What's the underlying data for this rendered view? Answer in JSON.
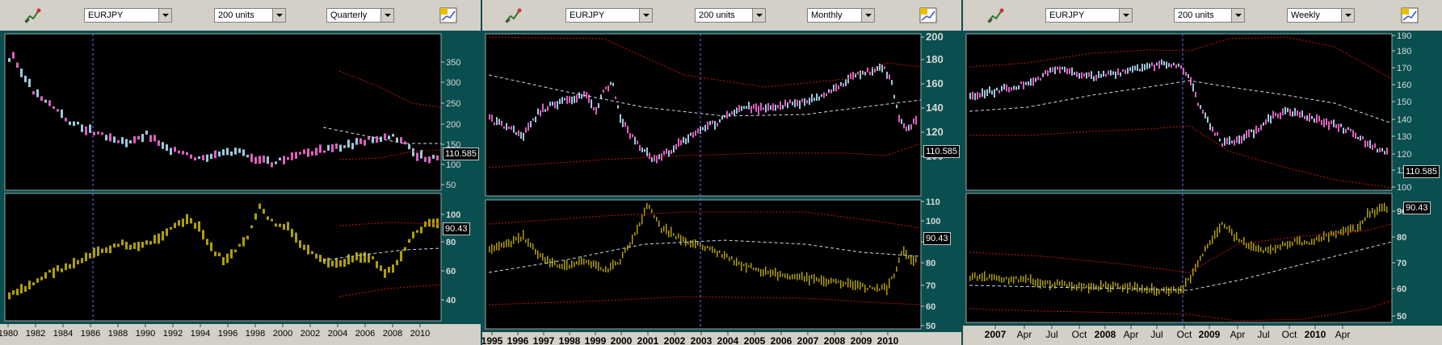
{
  "panels": [
    {
      "id": "quarterly",
      "symbol": "EURJPY",
      "units": "200 units",
      "period": "Quarterly",
      "price_badge": "110.585",
      "indicator_badge": "90.43",
      "price_ticks": [
        "350",
        "300",
        "250",
        "200",
        "150",
        "100",
        "50"
      ],
      "indicator_ticks": [
        "100",
        "80",
        "60",
        "40"
      ],
      "time_ticks": [
        "1980",
        "1982",
        "1984",
        "1986",
        "1988",
        "1990",
        "1992",
        "1994",
        "1996",
        "1998",
        "2000",
        "2002",
        "2004",
        "2006",
        "2008",
        "2010"
      ]
    },
    {
      "id": "monthly",
      "symbol": "EURJPY",
      "units": "200 units",
      "period": "Monthly",
      "price_badge": "110.585",
      "indicator_badge": "90.43",
      "price_ticks": [
        "200",
        "180",
        "160",
        "140",
        "120",
        "100"
      ],
      "indicator_ticks": [
        "110",
        "100",
        "90",
        "80",
        "70",
        "60",
        "50"
      ],
      "time_ticks": [
        "1995",
        "1996",
        "1997",
        "1998",
        "1999",
        "2000",
        "2001",
        "2002",
        "2003",
        "2004",
        "2005",
        "2006",
        "2007",
        "2008",
        "2009",
        "2010"
      ]
    },
    {
      "id": "weekly",
      "symbol": "EURJPY",
      "units": "200 units",
      "period": "Weekly",
      "price_badge": "110.585",
      "indicator_badge": "90.43",
      "price_ticks": [
        "190",
        "180",
        "170",
        "160",
        "150",
        "140",
        "130",
        "120",
        "110",
        "100"
      ],
      "indicator_ticks": [
        "90",
        "80",
        "70",
        "60",
        "50"
      ],
      "time_ticks": [
        "2007",
        "Apr",
        "Jul",
        "Oct",
        "2008",
        "Apr",
        "Jul",
        "Oct",
        "2009",
        "Apr",
        "Jul",
        "Oct",
        "2010",
        "Apr"
      ]
    }
  ],
  "colors": {
    "up_bar": "#9ec8dc",
    "down_bar": "#e060c0",
    "indicator": "#b0a000",
    "envelope": "#cc1111",
    "average": "#c8d8f0",
    "cursor": "#7070ff",
    "grid": "#606060"
  },
  "icons": {
    "tool": "chart-tool-icon",
    "settings": "chart-settings-icon"
  }
}
